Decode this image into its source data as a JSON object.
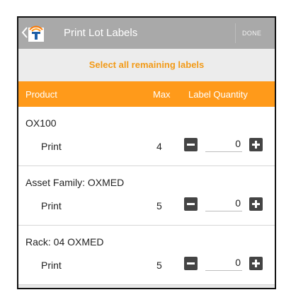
{
  "appbar": {
    "title": "Print Lot Labels",
    "done_label": "DONE",
    "back_icon": "chevron-left-icon",
    "logo_icon": "app-logo-icon"
  },
  "select_all": {
    "label": "Select all remaining labels"
  },
  "table": {
    "headers": {
      "product": "Product",
      "max": "Max",
      "label_quantity": "Label Quantity"
    },
    "rows": [
      {
        "name": "OX100",
        "action": "Print",
        "max": "4",
        "quantity": "0"
      },
      {
        "name": "Asset Family: OXMED",
        "action": "Print",
        "max": "5",
        "quantity": "0"
      },
      {
        "name": "Rack: 04 OXMED",
        "action": "Print",
        "max": "5",
        "quantity": "0"
      }
    ]
  },
  "colors": {
    "accent": "#ff9a1a",
    "link": "#f29a17",
    "appbar": "#a9a9a9",
    "stepper": "#444444"
  }
}
